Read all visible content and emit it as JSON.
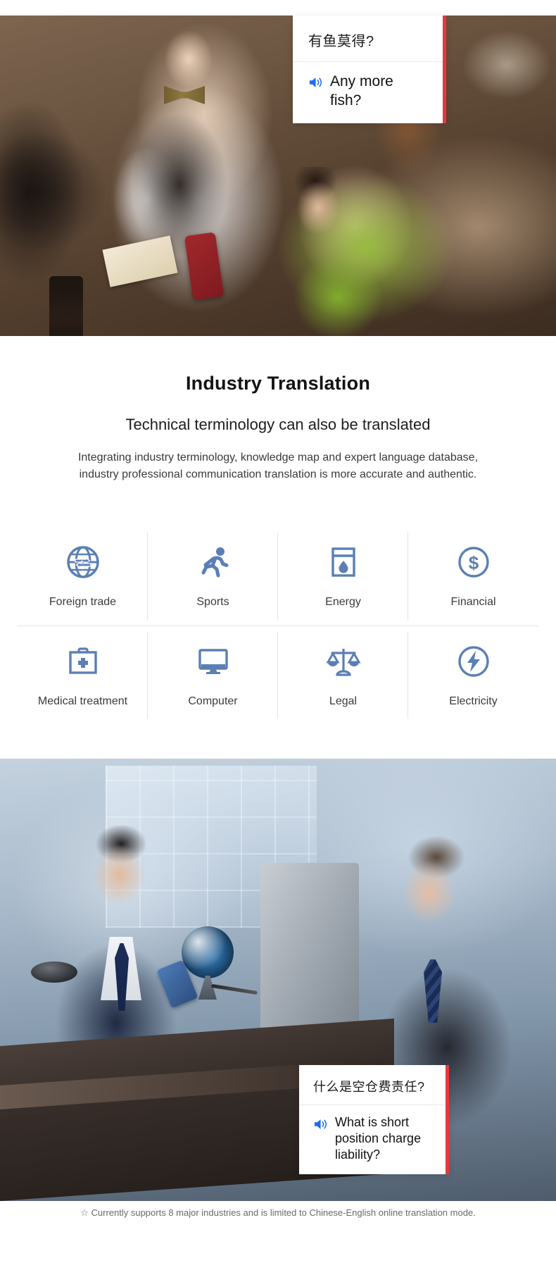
{
  "hero": {
    "alt": "waiter taking order from woman using translation phone in restaurant"
  },
  "callout_top": {
    "source_text": "有鱼莫得?",
    "translated_text": "Any more fish?",
    "speaker_icon": "speaker-icon",
    "accent_color": "#e8373d"
  },
  "section": {
    "title": "Industry Translation",
    "subtitle": "Technical terminology can also be translated",
    "description": "Integrating industry terminology, knowledge map and expert language database, industry professional communication translation is more accurate and authentic."
  },
  "industries": {
    "icon_color": "#5b7fb4",
    "items": [
      {
        "label": "Foreign trade",
        "icon": "globe-arrows-icon"
      },
      {
        "label": "Sports",
        "icon": "running-person-icon"
      },
      {
        "label": "Energy",
        "icon": "oil-drum-drop-icon"
      },
      {
        "label": "Financial",
        "icon": "dollar-coin-icon"
      },
      {
        "label": "Medical treatment",
        "icon": "first-aid-kit-icon"
      },
      {
        "label": "Computer",
        "icon": "monitor-icon"
      },
      {
        "label": "Legal",
        "icon": "scales-of-justice-icon"
      },
      {
        "label": "Electricity",
        "icon": "lightning-bolt-circle-icon"
      }
    ]
  },
  "bottom_photo": {
    "alt": "two businessmen at desk with translation phone and globe"
  },
  "callout_bottom": {
    "source_text": "什么是空仓费责任?",
    "translated_text": "What is short position charge liability?",
    "speaker_icon": "speaker-icon",
    "accent_color": "#e8373d"
  },
  "footer": {
    "star": "☆",
    "note": "Currently supports 8 major industries and is limited to Chinese-English online translation mode."
  }
}
